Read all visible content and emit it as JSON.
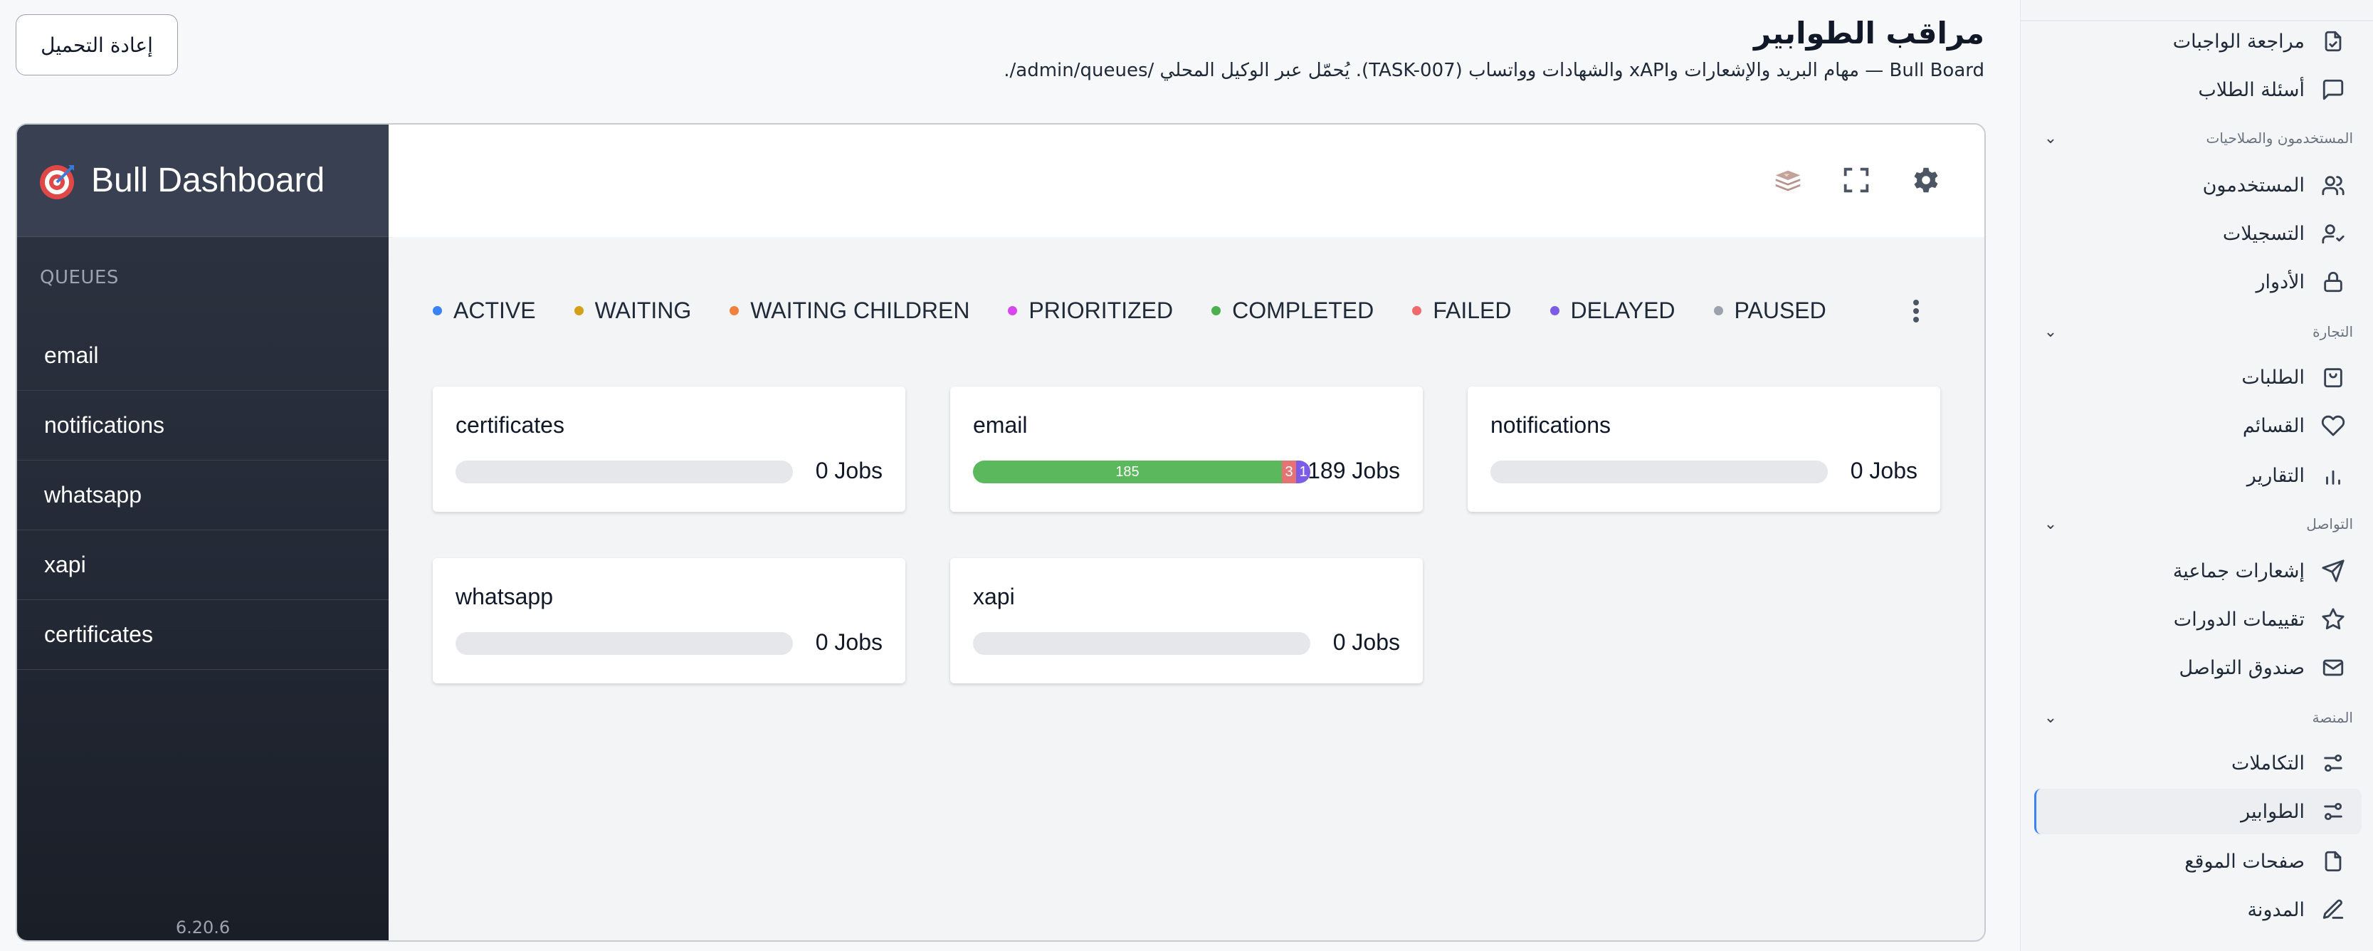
{
  "header": {
    "title": "مراقب الطوابير",
    "subtitle": "Bull Board — مهام البريد والإشعارات وxAPI والشهادات وواتساب (TASK-007). يُحمّل عبر الوكيل المحلي /admin/queues/.",
    "reload_label": "إعادة التحميل"
  },
  "sidebar": {
    "items": [
      {
        "label": "مراجعة الواجبات",
        "icon": "file-check-icon"
      },
      {
        "label": "أسئلة الطلاب",
        "icon": "message-square-icon"
      }
    ],
    "sections": [
      {
        "title": "المستخدمون والصلاحيات",
        "items": [
          {
            "label": "المستخدمون",
            "icon": "users-icon"
          },
          {
            "label": "التسجيلات",
            "icon": "user-check-icon"
          },
          {
            "label": "الأدوار",
            "icon": "lock-icon"
          }
        ]
      },
      {
        "title": "التجارة",
        "items": [
          {
            "label": "الطلبات",
            "icon": "shopping-bag-icon"
          },
          {
            "label": "القسائم",
            "icon": "heart-icon"
          },
          {
            "label": "التقارير",
            "icon": "bar-chart-icon"
          }
        ]
      },
      {
        "title": "التواصل",
        "items": [
          {
            "label": "إشعارات جماعية",
            "icon": "send-icon"
          },
          {
            "label": "تقييمات الدورات",
            "icon": "star-icon"
          },
          {
            "label": "صندوق التواصل",
            "icon": "mail-icon"
          }
        ]
      },
      {
        "title": "المنصة",
        "items": [
          {
            "label": "التكاملات",
            "icon": "sliders-icon"
          },
          {
            "label": "الطوابير",
            "icon": "sliders-icon",
            "active": true
          },
          {
            "label": "صفحات الموقع",
            "icon": "file-icon"
          },
          {
            "label": "المدونة",
            "icon": "edit-icon"
          }
        ]
      }
    ]
  },
  "bull": {
    "brand": "Bull Dashboard",
    "queues_title": "QUEUES",
    "queues": [
      "email",
      "notifications",
      "whatsapp",
      "xapi",
      "certificates"
    ],
    "version": "6.20.6",
    "statuses": [
      {
        "label": "ACTIVE",
        "color": "#3b82f6"
      },
      {
        "label": "WAITING",
        "color": "#d4a017"
      },
      {
        "label": "WAITING CHILDREN",
        "color": "#f0803c"
      },
      {
        "label": "PRIORITIZED",
        "color": "#d946ef"
      },
      {
        "label": "COMPLETED",
        "color": "#4caf50"
      },
      {
        "label": "FAILED",
        "color": "#ef6b6b"
      },
      {
        "label": "DELAYED",
        "color": "#7c5ce6"
      },
      {
        "label": "PAUSED",
        "color": "#9ca3af"
      }
    ],
    "cards": [
      {
        "name": "certificates",
        "jobs": "0 Jobs",
        "total": 0,
        "completed": 0,
        "failed": 0,
        "delayed": 0
      },
      {
        "name": "email",
        "jobs": "189 Jobs",
        "total": 189,
        "completed": 185,
        "failed": 3,
        "delayed": 1,
        "completed_label": "185",
        "failed_label": "3",
        "delayed_label": "1"
      },
      {
        "name": "notifications",
        "jobs": "0 Jobs",
        "total": 0,
        "completed": 0,
        "failed": 0,
        "delayed": 0
      },
      {
        "name": "whatsapp",
        "jobs": "0 Jobs",
        "total": 0,
        "completed": 0,
        "failed": 0,
        "delayed": 0
      },
      {
        "name": "xapi",
        "jobs": "0 Jobs",
        "total": 0,
        "completed": 0,
        "failed": 0,
        "delayed": 0
      }
    ]
  }
}
